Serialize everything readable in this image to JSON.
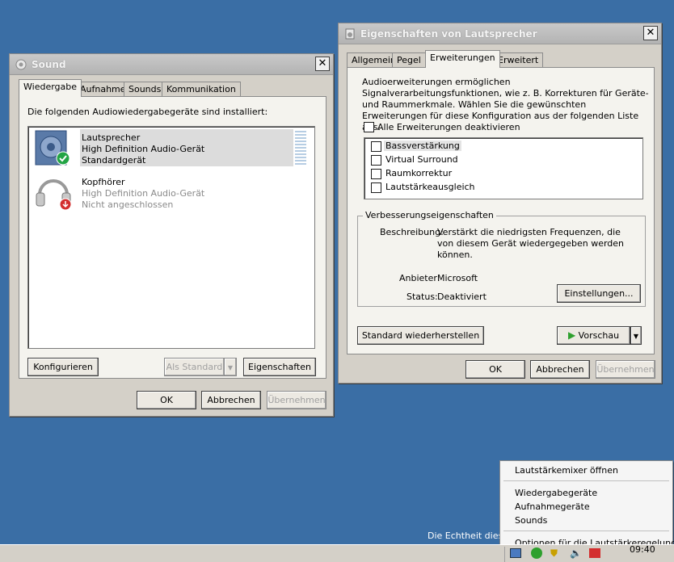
{
  "sound": {
    "title": "Sound",
    "tabs": [
      "Wiedergabe",
      "Aufnahme",
      "Sounds",
      "Kommunikation"
    ],
    "intro": "Die folgenden Audiowiedergabegeräte sind installiert:",
    "devices": [
      {
        "name": "Lautsprecher",
        "desc": "High Definition Audio-Gerät",
        "status": "Standardgerät"
      },
      {
        "name": "Kopfhörer",
        "desc": "High Definition Audio-Gerät",
        "status": "Nicht angeschlossen"
      }
    ],
    "configure": "Konfigurieren",
    "set_default": "Als Standard",
    "properties": "Eigenschaften",
    "ok": "OK",
    "cancel": "Abbrechen",
    "apply": "Übernehmen"
  },
  "props": {
    "title": "Eigenschaften von Lautsprecher",
    "tabs": [
      "Allgemein",
      "Pegel",
      "Erweiterungen",
      "Erweitert"
    ],
    "description": "Audioerweiterungen ermöglichen Signalverarbeitungsfunktionen, wie z. B. Korrekturen für Geräte- und Raummerkmale. Wählen Sie die gewünschten Erweiterungen für diese Konfiguration aus der folgenden Liste aus.",
    "disable_all": "Alle Erweiterungen deaktivieren",
    "enhancements": [
      "Bassverstärkung",
      "Virtual Surround",
      "Raumkorrektur",
      "Lautstärkeausgleich"
    ],
    "group_title": "Verbesserungseigenschaften",
    "desc_label": "Beschreibung:",
    "desc_value": "Verstärkt die niedrigsten Frequenzen, die von diesem Gerät wiedergegeben werden können.",
    "provider_label": "Anbieter:",
    "provider_value": "Microsoft",
    "status_label": "Status:",
    "status_value": "Deaktiviert",
    "settings": "Einstellungen...",
    "restore": "Standard wiederherstellen",
    "preview": "Vorschau",
    "ok": "OK",
    "cancel": "Abbrechen",
    "apply": "Übernehmen"
  },
  "context_menu": {
    "items": [
      "Lautstärkemixer öffnen",
      "Wiedergabegeräte",
      "Aufnahmegeräte",
      "Sounds",
      "Optionen für die Lautstärkeregelung"
    ]
  },
  "desktop": {
    "watermark": "Die Echtheit dieser"
  },
  "taskbar": {
    "clock": "09:40"
  }
}
